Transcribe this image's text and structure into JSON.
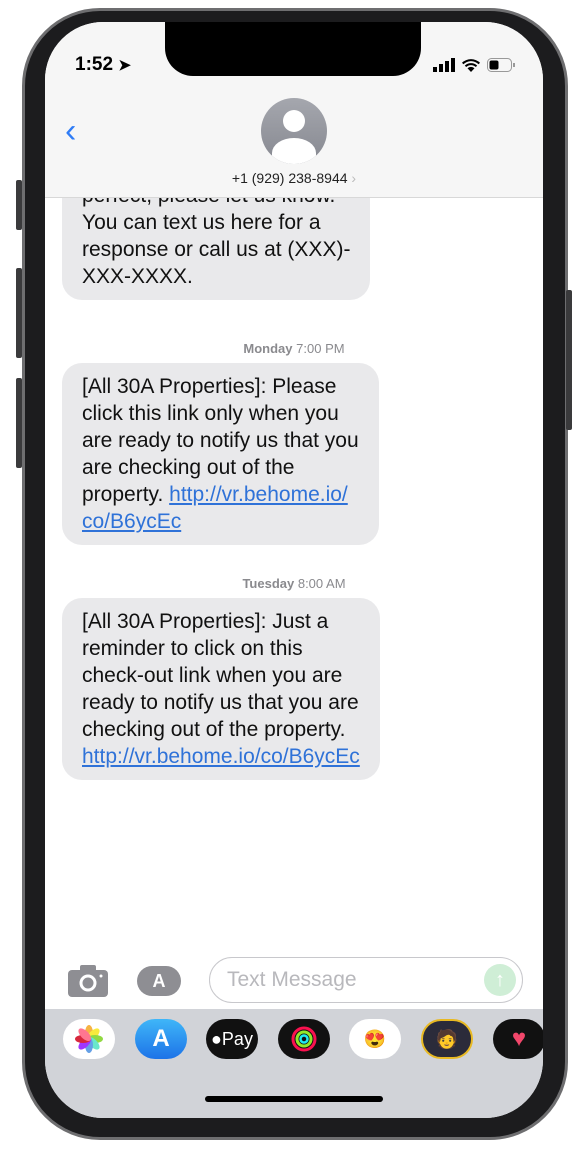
{
  "status": {
    "time": "1:52"
  },
  "header": {
    "contact": "+1 (929) 238-8944",
    "chevron": "›"
  },
  "messages": [
    {
      "lines": [
        {
          "text": "perfect, please let us know."
        },
        {
          "text": "You can text us here for a"
        },
        {
          "text": "response or call us at (XXX)-"
        },
        {
          "text": "XXX-XXXX."
        }
      ]
    },
    {
      "timestamp_day": "Monday",
      "timestamp_time": "7:00 PM",
      "lines": [
        {
          "text": "[All 30A Properties]: Please"
        },
        {
          "text": "click this link only when you"
        },
        {
          "text": "are ready to notify us that you"
        },
        {
          "text": "are checking out of the"
        },
        {
          "text": "property. ",
          "link": "http://vr.behome.io/"
        },
        {
          "link": "co/B6ycEc"
        }
      ]
    },
    {
      "timestamp_day": "Tuesday",
      "timestamp_time": "8:00 AM",
      "lines": [
        {
          "text": "[All 30A Properties]: Just a"
        },
        {
          "text": "reminder to click on this"
        },
        {
          "text": "check-out link when you are"
        },
        {
          "text": "ready to notify us that you are"
        },
        {
          "text": "checking out of the property."
        },
        {
          "link": "http://vr.behome.io/co/B6ycEc"
        }
      ]
    }
  ],
  "input": {
    "placeholder": "Text Message"
  },
  "drawer": {
    "apps": [
      "photos",
      "app-store",
      "apple-pay",
      "activity",
      "memoji-stickers",
      "animoji",
      "digital-touch"
    ],
    "apple_pay_label": "Pay"
  },
  "colors": {
    "link": "#2f72d8",
    "bubble": "#e9e9eb",
    "accent": "#2f7cf6"
  }
}
